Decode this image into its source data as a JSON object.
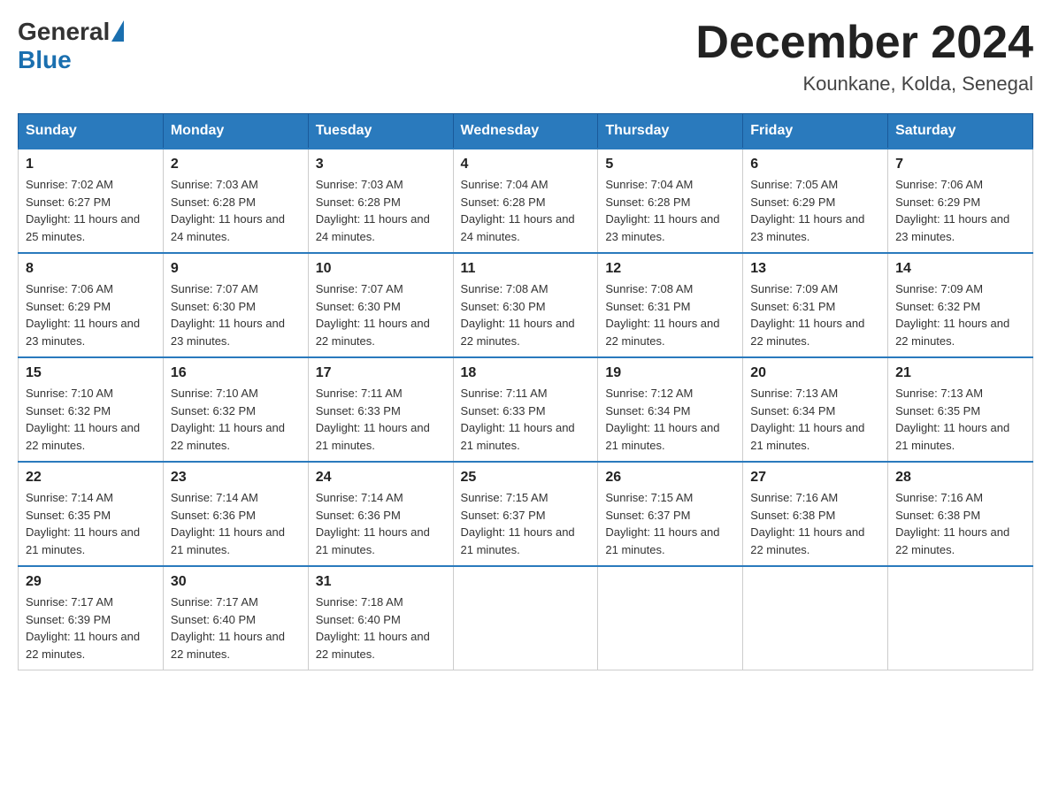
{
  "header": {
    "logo": {
      "general": "General",
      "blue": "Blue"
    },
    "title": "December 2024",
    "location": "Kounkane, Kolda, Senegal"
  },
  "calendar": {
    "days_of_week": [
      "Sunday",
      "Monday",
      "Tuesday",
      "Wednesday",
      "Thursday",
      "Friday",
      "Saturday"
    ],
    "weeks": [
      [
        {
          "day": "1",
          "sunrise": "7:02 AM",
          "sunset": "6:27 PM",
          "daylight": "11 hours and 25 minutes."
        },
        {
          "day": "2",
          "sunrise": "7:03 AM",
          "sunset": "6:28 PM",
          "daylight": "11 hours and 24 minutes."
        },
        {
          "day": "3",
          "sunrise": "7:03 AM",
          "sunset": "6:28 PM",
          "daylight": "11 hours and 24 minutes."
        },
        {
          "day": "4",
          "sunrise": "7:04 AM",
          "sunset": "6:28 PM",
          "daylight": "11 hours and 24 minutes."
        },
        {
          "day": "5",
          "sunrise": "7:04 AM",
          "sunset": "6:28 PM",
          "daylight": "11 hours and 23 minutes."
        },
        {
          "day": "6",
          "sunrise": "7:05 AM",
          "sunset": "6:29 PM",
          "daylight": "11 hours and 23 minutes."
        },
        {
          "day": "7",
          "sunrise": "7:06 AM",
          "sunset": "6:29 PM",
          "daylight": "11 hours and 23 minutes."
        }
      ],
      [
        {
          "day": "8",
          "sunrise": "7:06 AM",
          "sunset": "6:29 PM",
          "daylight": "11 hours and 23 minutes."
        },
        {
          "day": "9",
          "sunrise": "7:07 AM",
          "sunset": "6:30 PM",
          "daylight": "11 hours and 23 minutes."
        },
        {
          "day": "10",
          "sunrise": "7:07 AM",
          "sunset": "6:30 PM",
          "daylight": "11 hours and 22 minutes."
        },
        {
          "day": "11",
          "sunrise": "7:08 AM",
          "sunset": "6:30 PM",
          "daylight": "11 hours and 22 minutes."
        },
        {
          "day": "12",
          "sunrise": "7:08 AM",
          "sunset": "6:31 PM",
          "daylight": "11 hours and 22 minutes."
        },
        {
          "day": "13",
          "sunrise": "7:09 AM",
          "sunset": "6:31 PM",
          "daylight": "11 hours and 22 minutes."
        },
        {
          "day": "14",
          "sunrise": "7:09 AM",
          "sunset": "6:32 PM",
          "daylight": "11 hours and 22 minutes."
        }
      ],
      [
        {
          "day": "15",
          "sunrise": "7:10 AM",
          "sunset": "6:32 PM",
          "daylight": "11 hours and 22 minutes."
        },
        {
          "day": "16",
          "sunrise": "7:10 AM",
          "sunset": "6:32 PM",
          "daylight": "11 hours and 22 minutes."
        },
        {
          "day": "17",
          "sunrise": "7:11 AM",
          "sunset": "6:33 PM",
          "daylight": "11 hours and 21 minutes."
        },
        {
          "day": "18",
          "sunrise": "7:11 AM",
          "sunset": "6:33 PM",
          "daylight": "11 hours and 21 minutes."
        },
        {
          "day": "19",
          "sunrise": "7:12 AM",
          "sunset": "6:34 PM",
          "daylight": "11 hours and 21 minutes."
        },
        {
          "day": "20",
          "sunrise": "7:13 AM",
          "sunset": "6:34 PM",
          "daylight": "11 hours and 21 minutes."
        },
        {
          "day": "21",
          "sunrise": "7:13 AM",
          "sunset": "6:35 PM",
          "daylight": "11 hours and 21 minutes."
        }
      ],
      [
        {
          "day": "22",
          "sunrise": "7:14 AM",
          "sunset": "6:35 PM",
          "daylight": "11 hours and 21 minutes."
        },
        {
          "day": "23",
          "sunrise": "7:14 AM",
          "sunset": "6:36 PM",
          "daylight": "11 hours and 21 minutes."
        },
        {
          "day": "24",
          "sunrise": "7:14 AM",
          "sunset": "6:36 PM",
          "daylight": "11 hours and 21 minutes."
        },
        {
          "day": "25",
          "sunrise": "7:15 AM",
          "sunset": "6:37 PM",
          "daylight": "11 hours and 21 minutes."
        },
        {
          "day": "26",
          "sunrise": "7:15 AM",
          "sunset": "6:37 PM",
          "daylight": "11 hours and 21 minutes."
        },
        {
          "day": "27",
          "sunrise": "7:16 AM",
          "sunset": "6:38 PM",
          "daylight": "11 hours and 22 minutes."
        },
        {
          "day": "28",
          "sunrise": "7:16 AM",
          "sunset": "6:38 PM",
          "daylight": "11 hours and 22 minutes."
        }
      ],
      [
        {
          "day": "29",
          "sunrise": "7:17 AM",
          "sunset": "6:39 PM",
          "daylight": "11 hours and 22 minutes."
        },
        {
          "day": "30",
          "sunrise": "7:17 AM",
          "sunset": "6:40 PM",
          "daylight": "11 hours and 22 minutes."
        },
        {
          "day": "31",
          "sunrise": "7:18 AM",
          "sunset": "6:40 PM",
          "daylight": "11 hours and 22 minutes."
        },
        null,
        null,
        null,
        null
      ]
    ]
  }
}
